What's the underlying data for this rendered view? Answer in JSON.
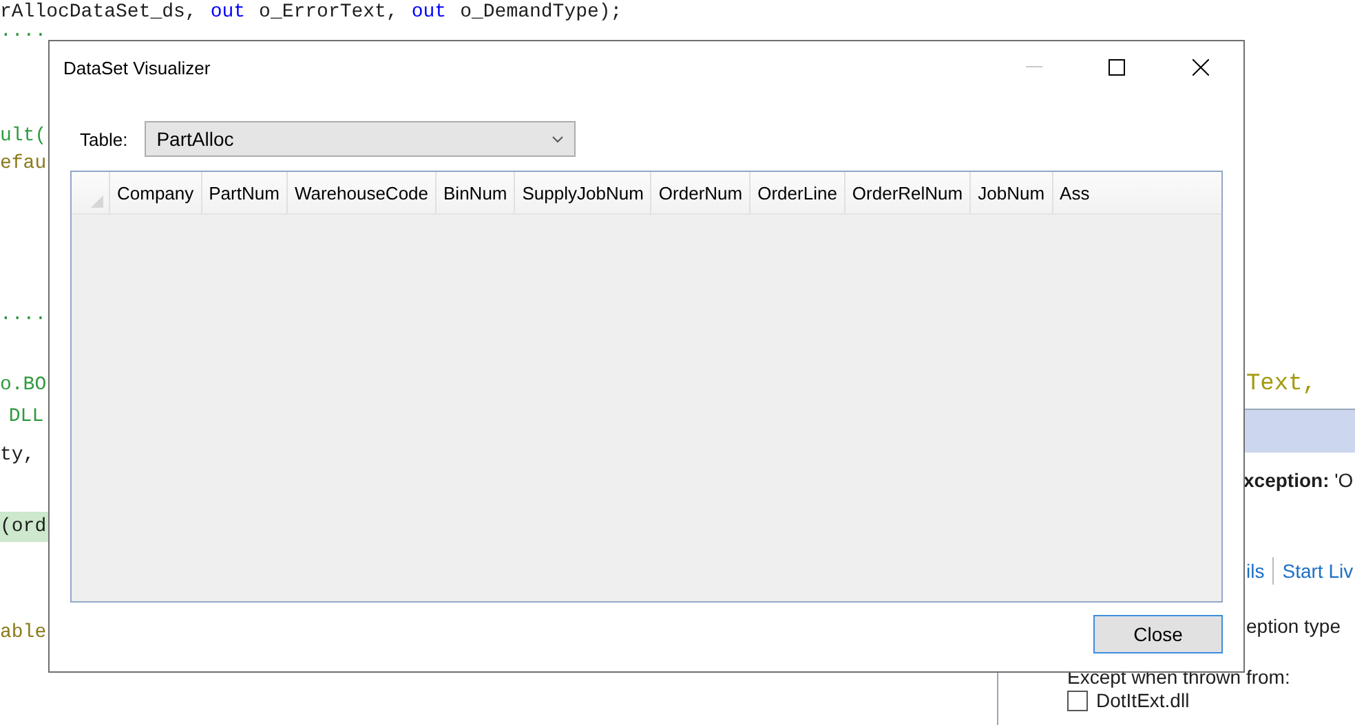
{
  "editor": {
    "lines": [
      {
        "segments": [
          {
            "text": "rAllocDataSet_ds,",
            "color": "#1e1e1e"
          },
          {
            "text": "out",
            "color": "#0000ff"
          },
          {
            "text": "o_ErrorText,",
            "color": "#1e1e1e"
          },
          {
            "text": "out",
            "color": "#0000ff"
          },
          {
            "text": "o_DemandType);",
            "color": "#1e1e1e"
          }
        ],
        "highlighted": false
      },
      {
        "segments": [
          {
            "text": "....",
            "color": "#2f9a3f"
          }
        ],
        "highlighted": false
      },
      {
        "segments": [
          {
            "text": "ult(",
            "color": "#2f9a3f"
          }
        ],
        "highlighted": false
      },
      {
        "segments": [
          {
            "text": "efau",
            "color": "#8a7a1a"
          }
        ],
        "highlighted": false
      },
      {
        "segments": [
          {
            "text": "....",
            "color": "#2f9a3f"
          }
        ],
        "highlighted": false
      },
      {
        "segments": [
          {
            "text": "o.BO",
            "color": "#2f9a3f"
          }
        ],
        "tail": {
          "text": "Text,",
          "color": "#a39a10"
        },
        "highlighted": false
      },
      {
        "segments": [
          {
            "text": " DLL",
            "color": "#2f9a3f"
          }
        ],
        "highlighted": false
      },
      {
        "segments": [
          {
            "text": "ty,",
            "color": "#1e1e1e"
          }
        ],
        "highlighted": false
      },
      {
        "segments": [
          {
            "text": "(ord",
            "color": "#1e1e1e"
          }
        ],
        "highlighted": true
      },
      {
        "segments": [
          {
            "text": "able",
            "color": "#8a7a1a"
          }
        ],
        "highlighted": false
      }
    ]
  },
  "exception_panel": {
    "message": "**xception:** 'O",
    "links": [
      "ils",
      "Start Liv"
    ],
    "option_text": "eption type",
    "except_label": "Except when thrown from:",
    "modules": [
      {
        "label": "DotItExt.dll",
        "checked": false
      }
    ]
  },
  "dialog": {
    "title": "DataSet Visualizer",
    "minimize_disabled": true,
    "table_label": "Table:",
    "table_value": "PartAlloc",
    "grid": {
      "columns": [
        "Company",
        "PartNum",
        "WarehouseCode",
        "BinNum",
        "SupplyJobNum",
        "OrderNum",
        "OrderLine",
        "OrderRelNum",
        "JobNum",
        "Ass"
      ]
    },
    "close_button": "Close"
  }
}
